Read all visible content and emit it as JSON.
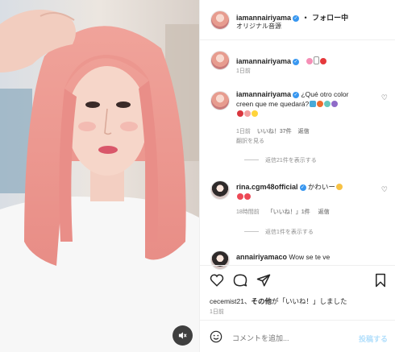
{
  "header": {
    "username": "iamannairiyama",
    "dot": "•",
    "follow_label": "フォロー中",
    "audio_label": "オリジナル音源"
  },
  "caption": {
    "username": "iamannairiyama",
    "emojis": [
      "flower",
      "heart-red",
      "heart-pink"
    ],
    "time": "1日前"
  },
  "comments": [
    {
      "username": "iamannairiyama",
      "text_line1": "¿Qué otro color",
      "text_line2": "creen que me quedará?",
      "time": "1日前",
      "likes": "いいね！37件",
      "reply": "返信",
      "translate": "翻訳を見る",
      "view_replies": "返信21件を表示する"
    },
    {
      "username": "rina.cgm48official",
      "text": "かわいー",
      "time": "18時間前",
      "likes": "「いいね！」1件",
      "reply": "返信",
      "view_replies": "返信1件を表示する"
    },
    {
      "username": "annairiyamaco",
      "text": "Wow se te ve"
    }
  ],
  "likes_line": {
    "name": "cecemist21",
    "sep": "、",
    "others": "その他",
    "rest": "が「いいね！」しました"
  },
  "post_time": "1日前",
  "comment_box": {
    "placeholder": "コメントを追加...",
    "post_label": "投稿する"
  },
  "colors": {
    "verified": "#3897f0",
    "post_button_disabled": "#b2dffc",
    "heart_red": "#ed4956"
  },
  "icons": [
    "mute-icon",
    "heart-icon",
    "comment-icon",
    "share-icon",
    "bookmark-icon",
    "smile-icon",
    "more-icon"
  ]
}
